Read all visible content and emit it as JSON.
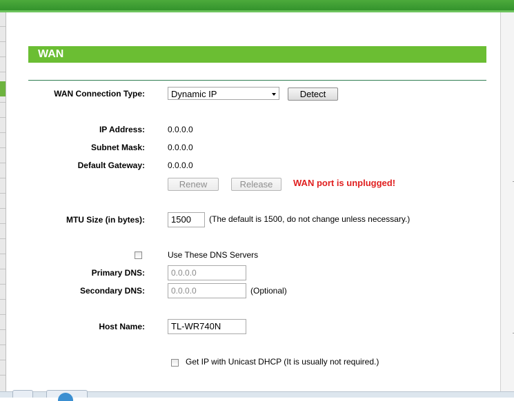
{
  "section": {
    "title": "WAN"
  },
  "connection_type": {
    "label": "WAN Connection Type:",
    "selected": "Dynamic IP",
    "detect_label": "Detect"
  },
  "status": {
    "ip_label": "IP Address:",
    "ip_value": "0.0.0.0",
    "mask_label": "Subnet Mask:",
    "mask_value": "0.0.0.0",
    "gateway_label": "Default Gateway:",
    "gateway_value": "0.0.0.0",
    "renew_label": "Renew",
    "release_label": "Release",
    "warning": "WAN port is unplugged!"
  },
  "mtu": {
    "label": "MTU Size (in bytes):",
    "value": "1500",
    "note": "(The default is 1500, do not change unless necessary.)"
  },
  "dns": {
    "use_label": "Use These DNS Servers",
    "use_checked": false,
    "primary_label": "Primary DNS:",
    "primary_placeholder": "0.0.0.0",
    "secondary_label": "Secondary DNS:",
    "secondary_placeholder": "0.0.0.0",
    "optional_note": "(Optional)"
  },
  "host": {
    "label": "Host Name:",
    "value": "TL-WR740N"
  },
  "unicast": {
    "label": "Get IP with Unicast DHCP (It is usually not required.)",
    "checked": false
  },
  "colors": {
    "header_green": "#6bbe33",
    "warning_red": "#e02020",
    "topbar_green": "#2f8f2a"
  }
}
